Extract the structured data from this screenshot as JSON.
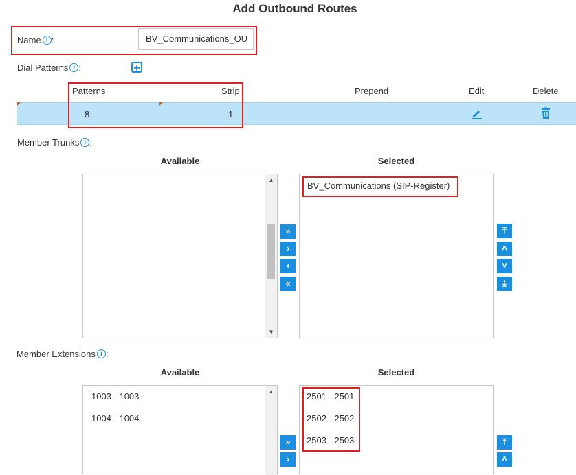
{
  "page_title": "Add Outbound Routes",
  "name_field": {
    "label": "Name",
    "colon": ":",
    "value": "BV_Communications_OU"
  },
  "dial_patterns": {
    "label": "Dial Patterns",
    "colon": ":",
    "add_symbol": "+",
    "columns": {
      "patterns": "Patterns",
      "strip": "Strip",
      "prepend": "Prepend",
      "edit": "Edit",
      "delete": "Delete"
    },
    "rows": [
      {
        "pattern": "8.",
        "strip": "1",
        "prepend": ""
      }
    ]
  },
  "member_trunks": {
    "label": "Member Trunks",
    "colon": ":",
    "available_header": "Available",
    "selected_header": "Selected",
    "available_items": [],
    "selected_items": [
      "BV_Communications (SIP-Register)"
    ]
  },
  "member_extensions": {
    "label": "Member Extensions",
    "colon": ":",
    "available_header": "Available",
    "selected_header": "Selected",
    "available_items": [
      "1003 - 1003",
      "1004 - 1004"
    ],
    "selected_items": [
      "2501 - 2501",
      "2502 - 2502",
      "2503 - 2503"
    ]
  },
  "buttons": {
    "move_all_right": "»",
    "move_right": "›",
    "move_left": "‹",
    "move_all_left": "«",
    "move_top": "⤒",
    "move_up": "˄",
    "move_down": "˅",
    "move_bottom": "⤓"
  },
  "icons": {
    "info": "info-icon",
    "edit": "pencil-icon",
    "delete": "trash-icon"
  },
  "colors": {
    "accent": "#1a8fdf",
    "highlight": "#e02020",
    "selected_row": "#bde3f8"
  }
}
